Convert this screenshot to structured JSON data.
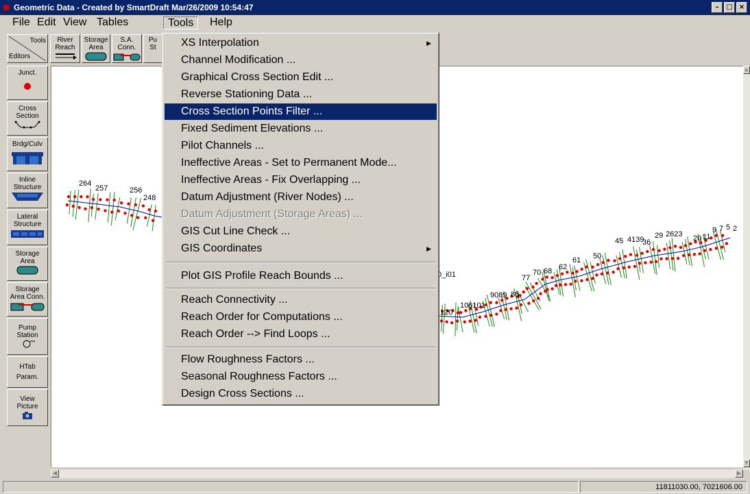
{
  "window": {
    "title": "Geometric Data - Created by SmartDraft Mar/26/2009 10:54:47"
  },
  "menubar": [
    "File",
    "Edit",
    "View",
    "Tables",
    "Tools",
    "Help"
  ],
  "toolbar": {
    "tools_label": "Tools",
    "editors_label": "Editors",
    "buttons": [
      {
        "line1": "River",
        "line2": "Reach"
      },
      {
        "line1": "Storage",
        "line2": "Area"
      },
      {
        "line1": "S.A.",
        "line2": "Conn."
      },
      {
        "line1": "Pu",
        "line2": "St"
      }
    ]
  },
  "editors": [
    {
      "line1": "Junct.",
      "line2": "",
      "icon": "red-dot-icon"
    },
    {
      "line1": "Cross",
      "line2": "Section",
      "icon": "cross-section-icon"
    },
    {
      "line1": "Brdg/Culv",
      "line2": "",
      "icon": "bridge-icon"
    },
    {
      "line1": "Inline",
      "line2": "Structure",
      "icon": "inline-structure-icon"
    },
    {
      "line1": "Lateral",
      "line2": "Structure",
      "icon": "lateral-structure-icon"
    },
    {
      "line1": "Storage",
      "line2": "Area",
      "icon": "storage-area-icon"
    },
    {
      "line1": "Storage",
      "line2": "Area Conn.",
      "icon": "storage-area-connection-icon"
    },
    {
      "line1": "Pump",
      "line2": "Station",
      "icon": "pump-icon"
    },
    {
      "line1": "HTab",
      "line2": "Param.",
      "icon": ""
    },
    {
      "line1": "View",
      "line2": "Picture",
      "icon": "camera-icon"
    }
  ],
  "tools_menu": {
    "items": [
      {
        "label": "XS Interpolation",
        "submenu": true
      },
      {
        "label": "Channel Modification ..."
      },
      {
        "label": "Graphical Cross Section Edit ..."
      },
      {
        "label": "Reverse Stationing Data ..."
      },
      {
        "label": "Cross Section Points Filter ...",
        "selected": true
      },
      {
        "label": "Fixed Sediment Elevations ..."
      },
      {
        "label": "Pilot Channels ..."
      },
      {
        "label": "Ineffective Areas - Set to Permanent Mode..."
      },
      {
        "label": "Ineffective Areas - Fix Overlapping  ..."
      },
      {
        "label": "Datum Adjustment (River Nodes) ..."
      },
      {
        "label": "Datum Adjustment (Storage Areas) ...",
        "disabled": true
      },
      {
        "label": "GIS Cut Line Check ..."
      },
      {
        "label": "GIS Coordinates",
        "submenu": true
      },
      {
        "label": "Plot GIS Profile Reach Bounds ..."
      },
      {
        "label": "Reach Connectivity ..."
      },
      {
        "label": "Reach Order for Computations ..."
      },
      {
        "label": "Reach Order --> Find Loops ..."
      },
      {
        "label": "Flow Roughness Factors ..."
      },
      {
        "label": "Seasonal Roughness Factors ..."
      },
      {
        "label": "Design Cross Sections ..."
      }
    ]
  },
  "map": {
    "labels": [
      "264",
      "257",
      "256",
      "248",
      "0_i01",
      "120",
      "106101",
      "9089",
      "86",
      "77",
      "70",
      "68",
      "62",
      "61",
      "50",
      "45",
      "4139",
      "36",
      "29",
      "2623",
      "20",
      "11",
      "9",
      "7",
      "5",
      "2"
    ]
  },
  "status": {
    "coords": "11811030.00, 7021606.00"
  }
}
